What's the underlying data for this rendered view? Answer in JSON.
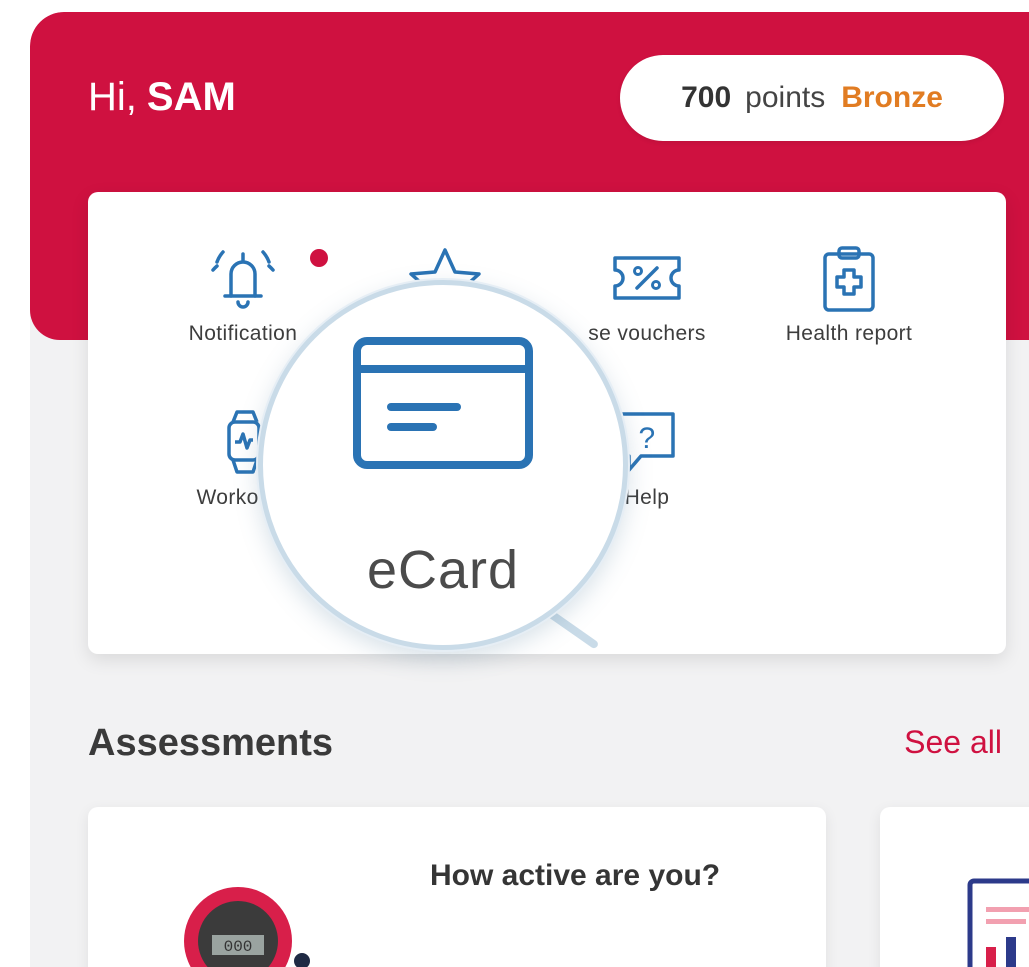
{
  "header": {
    "greeting": "Hi,",
    "user_name": "SAM",
    "points_value": "700",
    "points_word": "points",
    "tier": "Bronze"
  },
  "menu": {
    "items": [
      {
        "label": "Notification",
        "icon": "bell-icon"
      },
      {
        "label": "",
        "icon": "star-icon"
      },
      {
        "label": "se vouchers",
        "icon": "voucher-icon"
      },
      {
        "label": "Health report",
        "icon": "clipboard-plus-icon"
      },
      {
        "label": "Workout t",
        "icon": "smartwatch-icon"
      },
      {
        "label": "Help",
        "icon": "help-bubble-icon"
      }
    ],
    "magnified": {
      "label": "eCard",
      "icon": "ecard-icon"
    }
  },
  "assessments": {
    "title": "Assessments",
    "see_all": "See all",
    "cards": [
      {
        "title": "How active are you?",
        "display": "000"
      }
    ]
  },
  "colors": {
    "brand": "#cf1140",
    "tier": "#e17c22",
    "icon": "#2a73b4"
  }
}
